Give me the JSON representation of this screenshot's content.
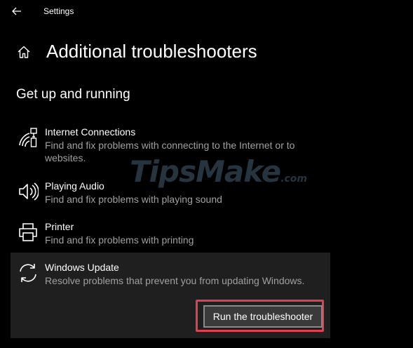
{
  "window": {
    "title": "Settings"
  },
  "page": {
    "title": "Additional troubleshooters"
  },
  "section": {
    "title": "Get up and running"
  },
  "items": [
    {
      "name": "Internet Connections",
      "description": "Find and fix problems with connecting to the Internet or to websites.",
      "icon": "wifi-network-icon"
    },
    {
      "name": "Playing Audio",
      "description": "Find and fix problems with playing sound",
      "icon": "speaker-icon"
    },
    {
      "name": "Printer",
      "description": "Find and fix problems with printing",
      "icon": "printer-icon"
    },
    {
      "name": "Windows Update",
      "description": "Resolve problems that prevent you from updating Windows.",
      "icon": "sync-icon"
    }
  ],
  "actions": {
    "run_label": "Run the troubleshooter"
  },
  "watermark": {
    "main": "TipsMake",
    "suffix": ".com"
  },
  "colors": {
    "background": "#000000",
    "selected_item": "#1f1f1f",
    "secondary_text": "#a0a0a0",
    "highlight_border": "#e0404f"
  }
}
